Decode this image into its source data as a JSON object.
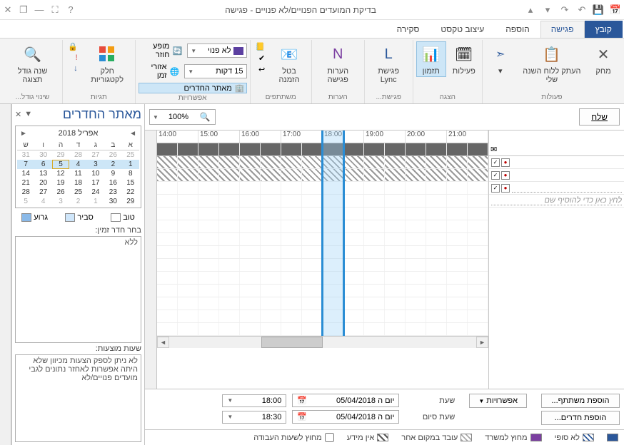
{
  "titlebar": {
    "title": "בדיקת המועדים הפנויים/לא פנויים - פגישה"
  },
  "menu": {
    "file": "קובץ",
    "meeting": "פגישה",
    "insert": "הוספה",
    "format": "עיצוב טקסט",
    "review": "סקירה"
  },
  "ribbon": {
    "groups": {
      "actions": {
        "label": "פעולות",
        "delete": "מחק",
        "copy_to_cal": "העתק ללוח השנה שלי"
      },
      "show": {
        "label": "הצגה",
        "appointment": "פעילות",
        "scheduling": "תזמון"
      },
      "meeting": {
        "label": "פגישת...",
        "lync": "פגישת Lync"
      },
      "notes": {
        "label": "הערות",
        "meeting_notes": "הערות פגישה"
      },
      "attendees": {
        "label": "משתתפים",
        "cancel": "בטל הזמנה"
      },
      "options": {
        "label": "אפשרויות",
        "show_as_label": "לא פנוי",
        "reminder_label": "15 דקות",
        "recurrence": "מופע חוזר",
        "time_zones": "אזורי זמן",
        "room_finder": "מאתר החדרים"
      },
      "tags": {
        "label": "תגיות",
        "categorize": "חלק לקטגוריות"
      },
      "zoom": {
        "label": "שינוי גודל...",
        "zoom": "שנה גודל תצוגה"
      }
    }
  },
  "room_finder": {
    "title": "מאתר החדרים",
    "cal": {
      "month_label": "אפריל 2018",
      "dow": [
        "א",
        "ב",
        "ג",
        "ד",
        "ה",
        "ו",
        "ש"
      ],
      "prev_trail": [
        "25",
        "26",
        "27",
        "28",
        "29",
        "30",
        "31"
      ],
      "weeks": [
        [
          "1",
          "2",
          "3",
          "4",
          "5",
          "6",
          "7"
        ],
        [
          "8",
          "9",
          "10",
          "11",
          "12",
          "13",
          "14"
        ],
        [
          "15",
          "16",
          "17",
          "18",
          "19",
          "20",
          "21"
        ],
        [
          "22",
          "23",
          "24",
          "25",
          "26",
          "27",
          "28"
        ]
      ],
      "last_row": [
        "29",
        "30",
        "1",
        "2",
        "3",
        "4",
        "5"
      ],
      "today": "5"
    },
    "legend": {
      "good": "טוב",
      "fair": "סביר",
      "poor": "גרוע"
    },
    "pick_room_label": "בחר חדר זמין:",
    "none": "ללא",
    "suggested_label": "שעות מוצעות:",
    "suggest_text": "לא ניתן לספק הצעות מכיוון שלא היתה אפשרות לאחזר נתונים לגבי מועדים פנויים/לא"
  },
  "sched": {
    "send": "שלח",
    "zoom": "100%",
    "hours": [
      "14:00",
      "15:00",
      "16:00",
      "17:00",
      "18:00",
      "19:00",
      "20:00",
      "21:00"
    ],
    "add_name_placeholder": "לחץ כאן כדי להוסיף שם",
    "options_btn": "אפשרויות",
    "add_attendees": "הוספת משתתף...",
    "add_rooms": "הוספת חדרים...",
    "start_label": "שעת",
    "end_label": "שעת סיום",
    "start_date": "יום ה 05/04/2018",
    "start_time": "18:00",
    "end_date": "יום ה 05/04/2018",
    "end_time": "18:30"
  },
  "legend_bar": {
    "busy": "לא סופי",
    "oof": "מחוץ למשרד",
    "wae": "עובד במקום אחר",
    "no_info": "אין מידע",
    "out_hours": "מחוץ לשעות העבודה"
  }
}
